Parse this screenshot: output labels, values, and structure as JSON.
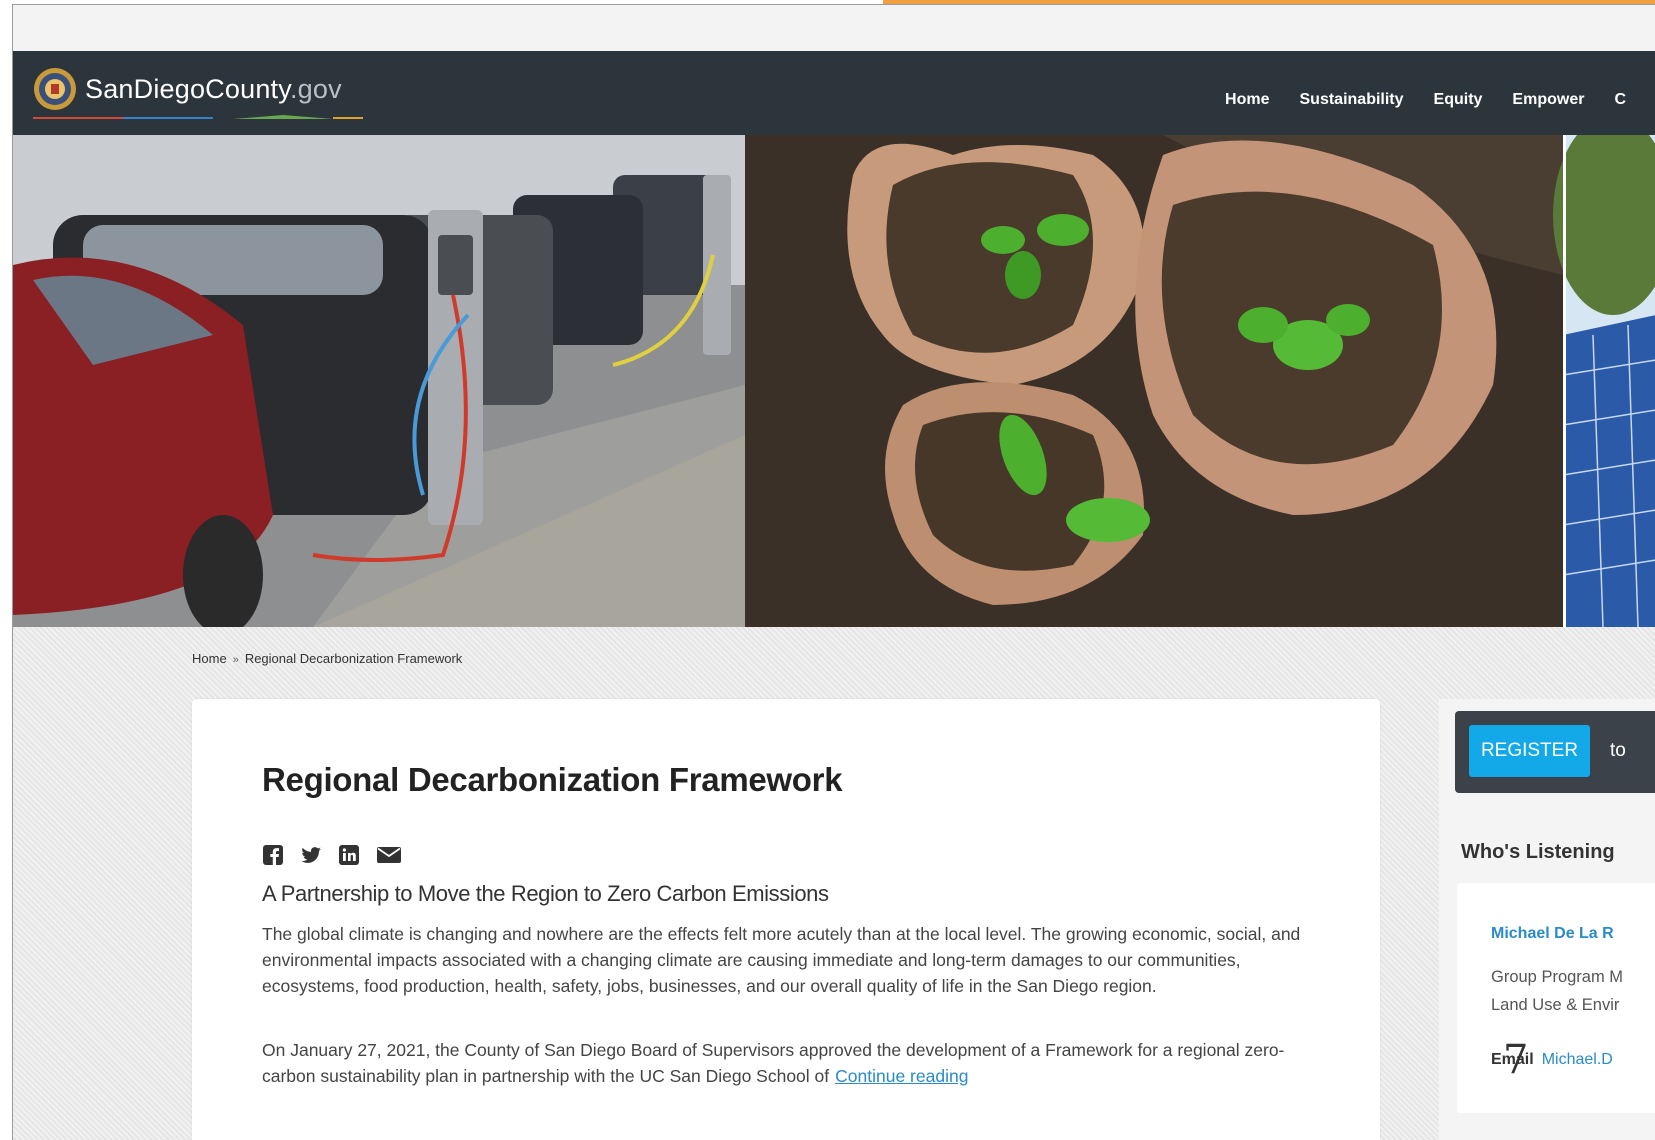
{
  "header": {
    "logo_main": "SanDiegoCounty",
    "logo_tld": ".gov",
    "nav": [
      "Home",
      "Sustainability",
      "Equity",
      "Empower",
      "C"
    ]
  },
  "breadcrumb": {
    "home": "Home",
    "separator": "»",
    "current": "Regional Decarbonization Framework"
  },
  "article": {
    "title": "Regional Decarbonization Framework",
    "subtitle": "A Partnership to Move the Region to Zero Carbon Emissions",
    "paragraph1": "The global climate is changing and nowhere are the effects felt more acutely than at the local level. The growing economic, social, and environmental impacts associated with a changing climate are causing immediate and long-term damages to our communities, ecosystems, food production, health, safety, jobs, businesses, and our overall quality of life in the San Diego region.",
    "paragraph2": "On January 27, 2021, the County of San Diego Board of Supervisors approved the development of a Framework for a regional zero-carbon sustainability plan in partnership with the UC San Diego School of",
    "continue_link": "Continue reading",
    "share_icons": [
      "facebook-icon",
      "twitter-icon",
      "linkedin-icon",
      "email-icon"
    ]
  },
  "sidebar": {
    "register_label": "REGISTER",
    "register_suffix": "to",
    "whos_listening": "Who's Listening",
    "person_name": "Michael De La R",
    "person_role_line1": "Group Program M",
    "person_role_line2": "Land Use & Envir",
    "email_label": "Email",
    "email_value": "Michael.D"
  },
  "overlay_number": "7",
  "colors": {
    "header_bg": "#2c343c",
    "link_blue": "#2a8bc8",
    "register_blue": "#13a8e8",
    "accent_orange": "#f0a040"
  }
}
